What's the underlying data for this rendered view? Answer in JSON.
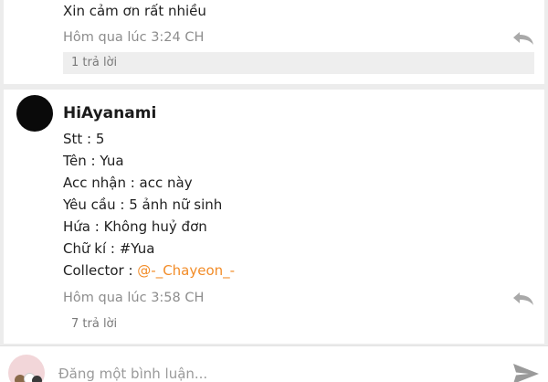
{
  "previous_comment": {
    "text": "Xin cảm ơn rất nhiều",
    "timestamp": "Hôm qua lúc 3:24 CH",
    "replies": "1 trả lời"
  },
  "comment": {
    "author": "HiAyanami",
    "lines": {
      "stt": "Stt : 5",
      "name": "Tên : Yua",
      "account": "Acc nhận : acc này",
      "request": "Yêu cầu : 5 ảnh nữ sinh",
      "promise": "Hứa : Không huỷ đơn",
      "signature": "Chữ kí : #Yua",
      "collector_label": "Collector : ",
      "collector_mention": "@-_Chayeon_-"
    },
    "timestamp": "Hôm qua lúc 3:58 CH",
    "replies": "7 trả lời"
  },
  "composer": {
    "placeholder": "Đăng một bình luận..."
  },
  "icons": {
    "reply": "reply-icon",
    "send": "send-icon"
  },
  "colors": {
    "mention": "#f28c28",
    "meta": "#8d8d8d",
    "background": "#ececec"
  }
}
